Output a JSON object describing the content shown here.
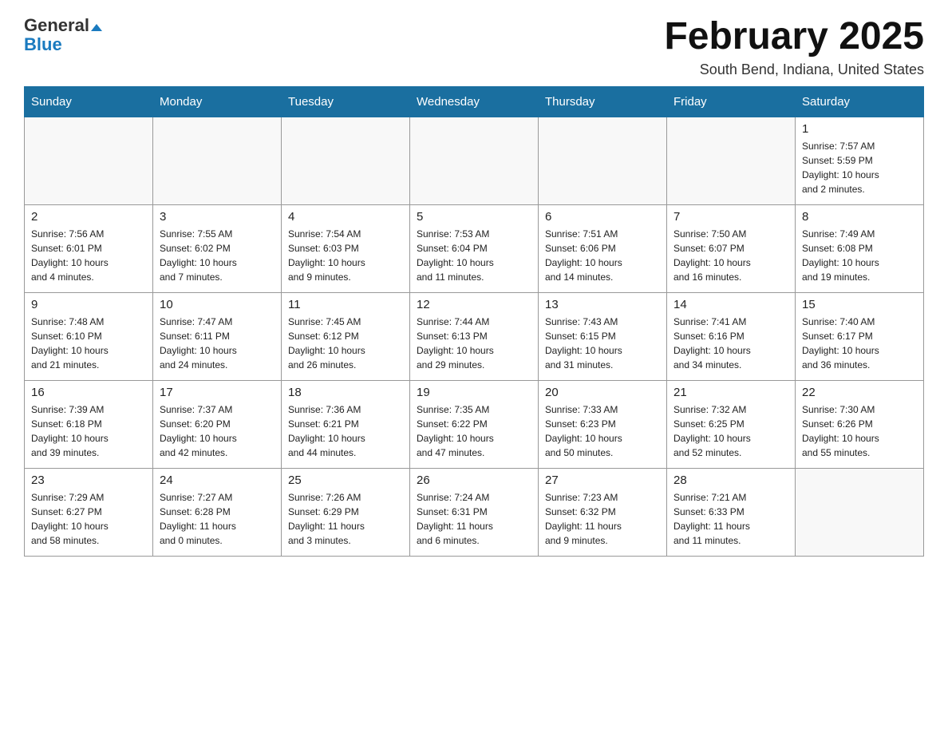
{
  "header": {
    "logo_general": "General",
    "logo_blue": "Blue",
    "main_title": "February 2025",
    "subtitle": "South Bend, Indiana, United States"
  },
  "days_of_week": [
    "Sunday",
    "Monday",
    "Tuesday",
    "Wednesday",
    "Thursday",
    "Friday",
    "Saturday"
  ],
  "weeks": [
    [
      {
        "day": "",
        "info": ""
      },
      {
        "day": "",
        "info": ""
      },
      {
        "day": "",
        "info": ""
      },
      {
        "day": "",
        "info": ""
      },
      {
        "day": "",
        "info": ""
      },
      {
        "day": "",
        "info": ""
      },
      {
        "day": "1",
        "info": "Sunrise: 7:57 AM\nSunset: 5:59 PM\nDaylight: 10 hours\nand 2 minutes."
      }
    ],
    [
      {
        "day": "2",
        "info": "Sunrise: 7:56 AM\nSunset: 6:01 PM\nDaylight: 10 hours\nand 4 minutes."
      },
      {
        "day": "3",
        "info": "Sunrise: 7:55 AM\nSunset: 6:02 PM\nDaylight: 10 hours\nand 7 minutes."
      },
      {
        "day": "4",
        "info": "Sunrise: 7:54 AM\nSunset: 6:03 PM\nDaylight: 10 hours\nand 9 minutes."
      },
      {
        "day": "5",
        "info": "Sunrise: 7:53 AM\nSunset: 6:04 PM\nDaylight: 10 hours\nand 11 minutes."
      },
      {
        "day": "6",
        "info": "Sunrise: 7:51 AM\nSunset: 6:06 PM\nDaylight: 10 hours\nand 14 minutes."
      },
      {
        "day": "7",
        "info": "Sunrise: 7:50 AM\nSunset: 6:07 PM\nDaylight: 10 hours\nand 16 minutes."
      },
      {
        "day": "8",
        "info": "Sunrise: 7:49 AM\nSunset: 6:08 PM\nDaylight: 10 hours\nand 19 minutes."
      }
    ],
    [
      {
        "day": "9",
        "info": "Sunrise: 7:48 AM\nSunset: 6:10 PM\nDaylight: 10 hours\nand 21 minutes."
      },
      {
        "day": "10",
        "info": "Sunrise: 7:47 AM\nSunset: 6:11 PM\nDaylight: 10 hours\nand 24 minutes."
      },
      {
        "day": "11",
        "info": "Sunrise: 7:45 AM\nSunset: 6:12 PM\nDaylight: 10 hours\nand 26 minutes."
      },
      {
        "day": "12",
        "info": "Sunrise: 7:44 AM\nSunset: 6:13 PM\nDaylight: 10 hours\nand 29 minutes."
      },
      {
        "day": "13",
        "info": "Sunrise: 7:43 AM\nSunset: 6:15 PM\nDaylight: 10 hours\nand 31 minutes."
      },
      {
        "day": "14",
        "info": "Sunrise: 7:41 AM\nSunset: 6:16 PM\nDaylight: 10 hours\nand 34 minutes."
      },
      {
        "day": "15",
        "info": "Sunrise: 7:40 AM\nSunset: 6:17 PM\nDaylight: 10 hours\nand 36 minutes."
      }
    ],
    [
      {
        "day": "16",
        "info": "Sunrise: 7:39 AM\nSunset: 6:18 PM\nDaylight: 10 hours\nand 39 minutes."
      },
      {
        "day": "17",
        "info": "Sunrise: 7:37 AM\nSunset: 6:20 PM\nDaylight: 10 hours\nand 42 minutes."
      },
      {
        "day": "18",
        "info": "Sunrise: 7:36 AM\nSunset: 6:21 PM\nDaylight: 10 hours\nand 44 minutes."
      },
      {
        "day": "19",
        "info": "Sunrise: 7:35 AM\nSunset: 6:22 PM\nDaylight: 10 hours\nand 47 minutes."
      },
      {
        "day": "20",
        "info": "Sunrise: 7:33 AM\nSunset: 6:23 PM\nDaylight: 10 hours\nand 50 minutes."
      },
      {
        "day": "21",
        "info": "Sunrise: 7:32 AM\nSunset: 6:25 PM\nDaylight: 10 hours\nand 52 minutes."
      },
      {
        "day": "22",
        "info": "Sunrise: 7:30 AM\nSunset: 6:26 PM\nDaylight: 10 hours\nand 55 minutes."
      }
    ],
    [
      {
        "day": "23",
        "info": "Sunrise: 7:29 AM\nSunset: 6:27 PM\nDaylight: 10 hours\nand 58 minutes."
      },
      {
        "day": "24",
        "info": "Sunrise: 7:27 AM\nSunset: 6:28 PM\nDaylight: 11 hours\nand 0 minutes."
      },
      {
        "day": "25",
        "info": "Sunrise: 7:26 AM\nSunset: 6:29 PM\nDaylight: 11 hours\nand 3 minutes."
      },
      {
        "day": "26",
        "info": "Sunrise: 7:24 AM\nSunset: 6:31 PM\nDaylight: 11 hours\nand 6 minutes."
      },
      {
        "day": "27",
        "info": "Sunrise: 7:23 AM\nSunset: 6:32 PM\nDaylight: 11 hours\nand 9 minutes."
      },
      {
        "day": "28",
        "info": "Sunrise: 7:21 AM\nSunset: 6:33 PM\nDaylight: 11 hours\nand 11 minutes."
      },
      {
        "day": "",
        "info": ""
      }
    ]
  ]
}
